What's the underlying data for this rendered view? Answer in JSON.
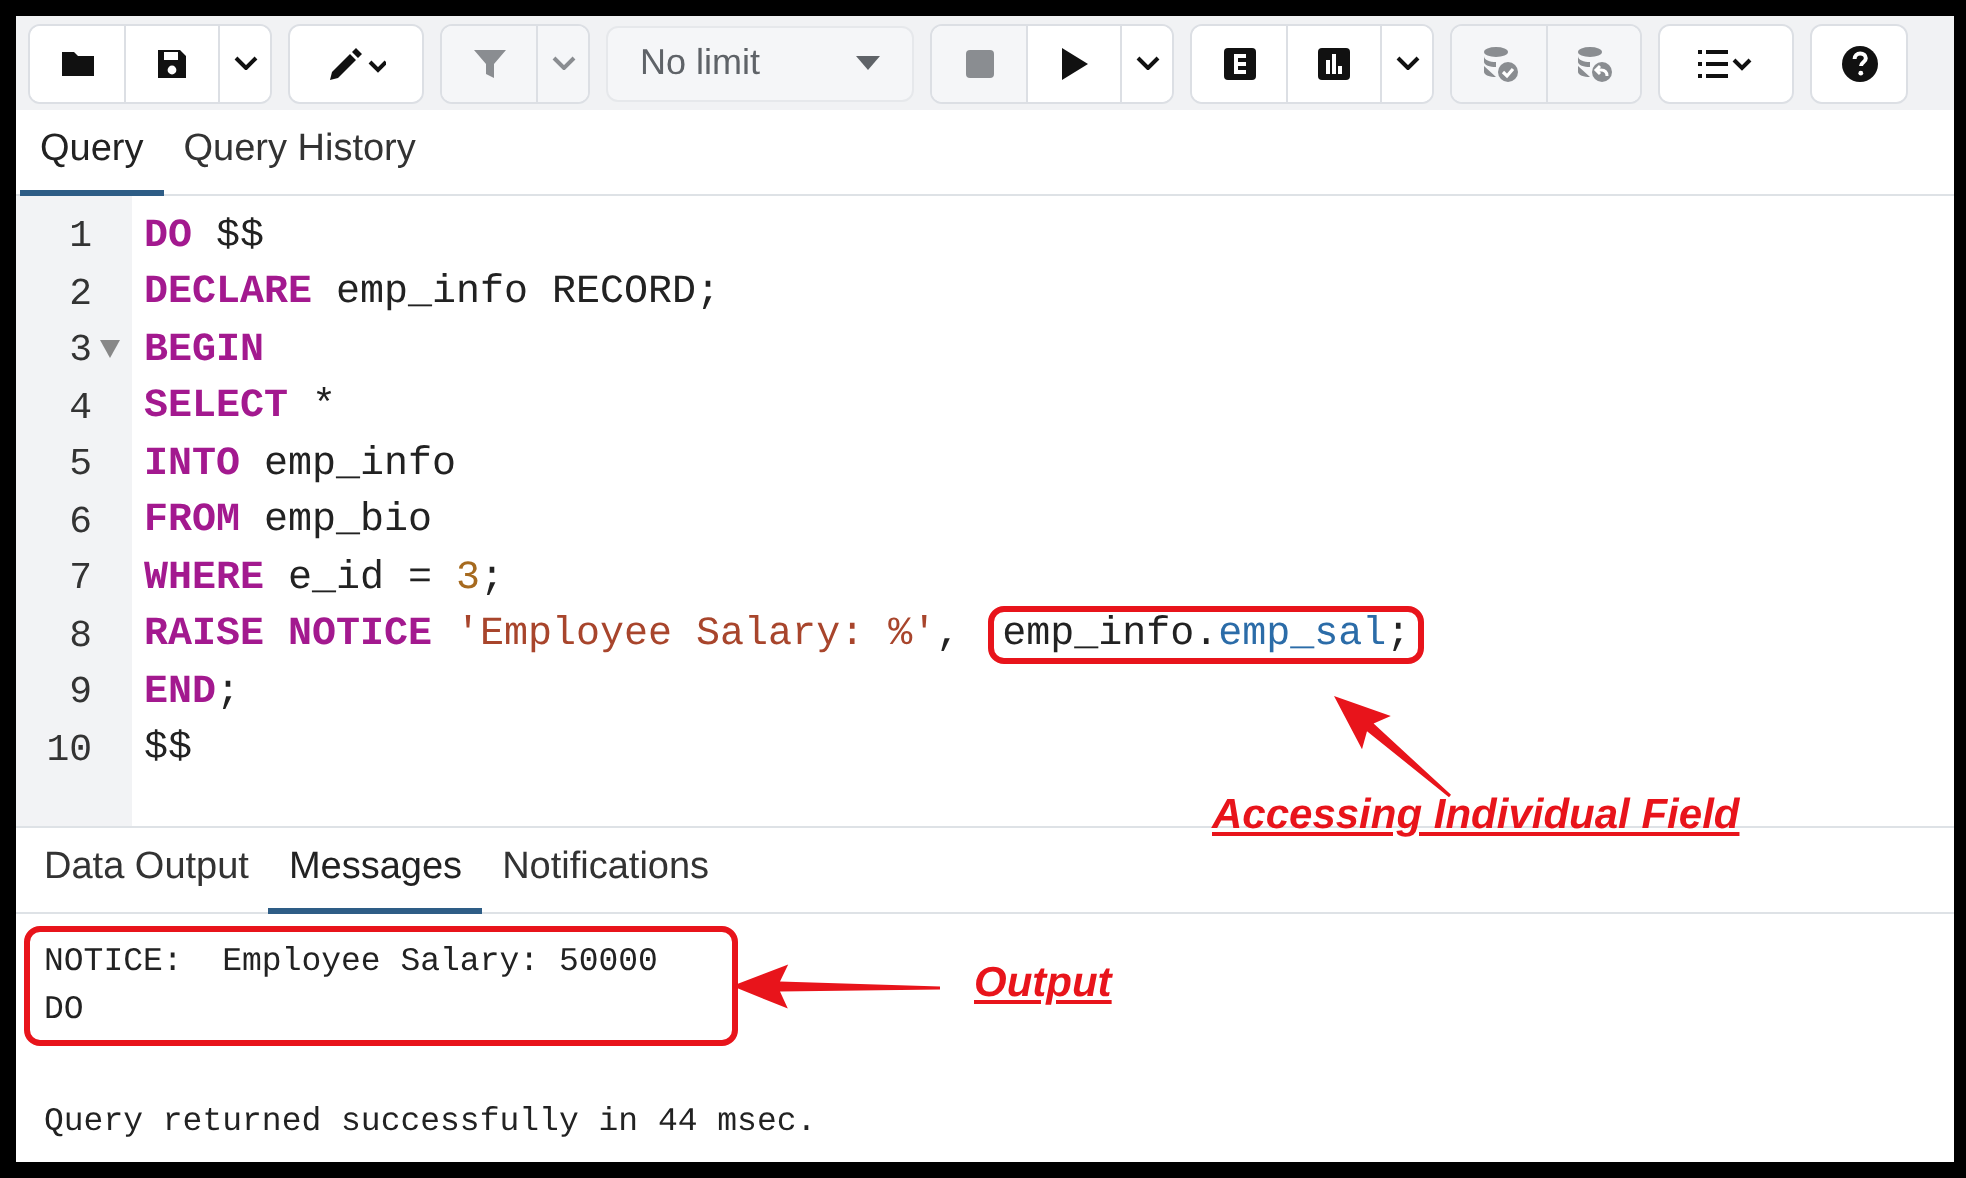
{
  "toolbar": {
    "buttons": [
      {
        "disabled": false
      },
      {
        "disabled": false
      },
      {
        "disabled": false
      },
      {
        "disabled": false
      },
      {
        "disabled": true
      },
      {
        "disabled": true
      },
      {
        "disabled": true
      },
      {
        "disabled": false
      },
      {
        "disabled": false
      },
      {
        "disabled": false
      },
      {
        "disabled": false
      },
      {
        "disabled": false
      },
      {
        "disabled": true
      },
      {
        "disabled": true
      },
      {
        "disabled": false
      },
      {
        "disabled": false
      }
    ],
    "limit": {
      "value": "No limit",
      "disabled": true
    }
  },
  "editor_tabs": [
    {
      "label": "Query",
      "selected": true
    },
    {
      "label": "Query History",
      "selected": false
    }
  ],
  "editor": {
    "lines": [
      {
        "number": "1",
        "foldable": false,
        "tokens": [
          {
            "kind": "keyword",
            "text": "DO"
          },
          {
            "kind": "plain",
            "text": " $$"
          }
        ]
      },
      {
        "number": "2",
        "foldable": false,
        "tokens": [
          {
            "kind": "keyword",
            "text": "DECLARE"
          },
          {
            "kind": "plain",
            "text": " emp_info RECORD;"
          }
        ]
      },
      {
        "number": "3",
        "foldable": true,
        "tokens": [
          {
            "kind": "keyword",
            "text": "BEGIN"
          }
        ]
      },
      {
        "number": "4",
        "foldable": false,
        "tokens": [
          {
            "kind": "keyword",
            "text": "SELECT"
          },
          {
            "kind": "plain",
            "text": " *"
          }
        ]
      },
      {
        "number": "5",
        "foldable": false,
        "tokens": [
          {
            "kind": "keyword",
            "text": "INTO"
          },
          {
            "kind": "plain",
            "text": " emp_info"
          }
        ]
      },
      {
        "number": "6",
        "foldable": false,
        "tokens": [
          {
            "kind": "keyword",
            "text": "FROM"
          },
          {
            "kind": "plain",
            "text": " emp_bio"
          }
        ]
      },
      {
        "number": "7",
        "foldable": false,
        "tokens": [
          {
            "kind": "keyword",
            "text": "WHERE"
          },
          {
            "kind": "plain",
            "text": " e_id = "
          },
          {
            "kind": "number",
            "text": "3"
          },
          {
            "kind": "plain",
            "text": ";"
          }
        ]
      },
      {
        "number": "8",
        "foldable": false,
        "tokens": [
          {
            "kind": "keyword",
            "text": "RAISE NOTICE"
          },
          {
            "kind": "string",
            "text": " 'Employee Salary: %'"
          },
          {
            "kind": "plain",
            "text": ", "
          },
          {
            "kind": "callout",
            "tokens": [
              {
                "kind": "plain",
                "text": "emp_info."
              },
              {
                "kind": "field",
                "text": "emp_sal"
              },
              {
                "kind": "plain",
                "text": ";"
              }
            ]
          }
        ]
      },
      {
        "number": "9",
        "foldable": false,
        "tokens": [
          {
            "kind": "keyword",
            "text": "END"
          },
          {
            "kind": "plain",
            "text": ";"
          }
        ]
      },
      {
        "number": "10",
        "foldable": false,
        "tokens": [
          {
            "kind": "plain",
            "text": "$$"
          }
        ]
      }
    ]
  },
  "output_tabs": [
    {
      "label": "Data Output",
      "selected": false
    },
    {
      "label": "Messages",
      "selected": true
    },
    {
      "label": "Notifications",
      "selected": false
    }
  ],
  "messages": [
    {
      "kind": "callout",
      "lines": [
        "NOTICE:  Employee Salary: 50000",
        "DO"
      ]
    },
    {
      "kind": "plain",
      "lines": [
        "Query returned successfully in 44 msec."
      ]
    }
  ],
  "annotations": [
    {
      "label": "Accessing Individual Field"
    },
    {
      "label": "Output"
    }
  ]
}
